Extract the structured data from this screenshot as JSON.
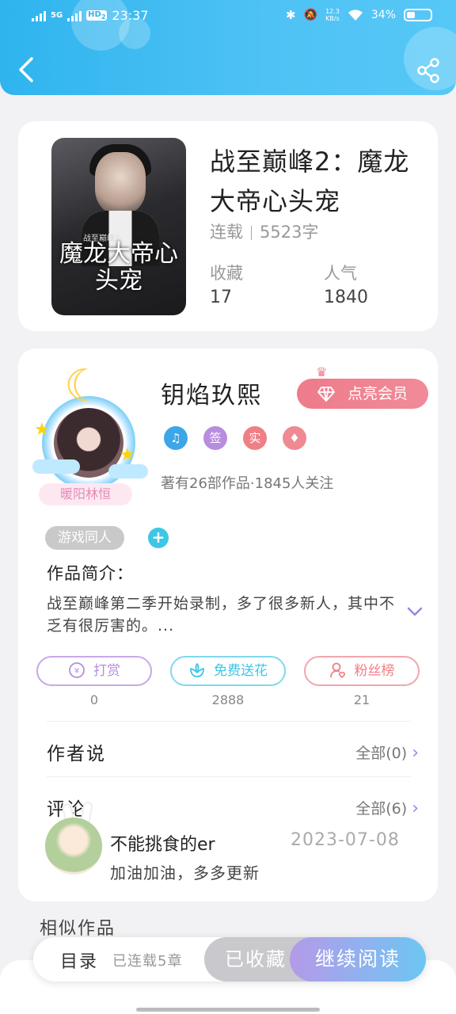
{
  "status_bar": {
    "network": "5G",
    "hd": "HD",
    "hd_sub": "2",
    "time": "23:37",
    "speed_top": "12.3",
    "speed_bottom": "KB/s",
    "battery": "34%"
  },
  "book": {
    "title": "战至巅峰2：魔龙大帝心头宠",
    "status": "连载",
    "word_count": "5523字",
    "favorites_label": "收藏",
    "favorites_value": "17",
    "popularity_label": "人气",
    "popularity_value": "1840",
    "cover_title": "魔龙大帝心头宠",
    "cover_subtitle": "战至巅峰2"
  },
  "author": {
    "name": "钥焰玖熙",
    "nickname": "暖阳林恒",
    "vip_button": "点亮会员",
    "badges": [
      {
        "label": "♫",
        "color": "#3da6e8"
      },
      {
        "label": "签",
        "color": "#b88ce0"
      },
      {
        "label": "实",
        "color": "#ef7f86"
      },
      {
        "label": "♦",
        "color": "#ef8a92"
      }
    ],
    "works_info": "著有26部作品·1845人关注"
  },
  "tags": {
    "tag": "游戏同人",
    "add": "+"
  },
  "intro": {
    "label": "作品简介：",
    "text": "战至巅峰第二季开始录制，多了很多新人，其中不乏有很厉害的。..."
  },
  "actions": [
    {
      "label": "打赏",
      "count": "0",
      "color": "#b68ee0"
    },
    {
      "label": "免费送花",
      "count": "2888",
      "color": "#3ec6e6"
    },
    {
      "label": "粉丝榜",
      "count": "21",
      "color": "#ef7f86"
    }
  ],
  "author_says": {
    "title": "作者说",
    "link": "全部(0)"
  },
  "comments": {
    "title": "评论",
    "link": "全部(6)",
    "items": [
      {
        "user": "不能挑食的er",
        "date": "2023-07-08",
        "text": "加油加油，多多更新"
      }
    ]
  },
  "similar": {
    "title": "相似作品"
  },
  "bottom_bar": {
    "toc_label": "目录",
    "toc_count": "已连载5章",
    "collected": "已收藏",
    "read": "继续阅读"
  },
  "colors": {
    "header_gradient_start": "#2fb4ee",
    "header_gradient_end": "#56c8f7",
    "vip": "#ee7b8a",
    "accent_purple": "#9b85e8"
  }
}
